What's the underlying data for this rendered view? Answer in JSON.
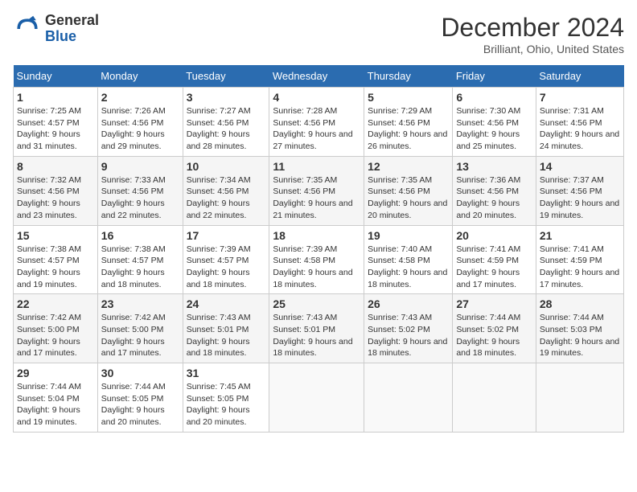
{
  "header": {
    "logo_general": "General",
    "logo_blue": "Blue",
    "month_title": "December 2024",
    "location": "Brilliant, Ohio, United States"
  },
  "days_of_week": [
    "Sunday",
    "Monday",
    "Tuesday",
    "Wednesday",
    "Thursday",
    "Friday",
    "Saturday"
  ],
  "weeks": [
    [
      {
        "day": "1",
        "sunrise": "7:25 AM",
        "sunset": "4:57 PM",
        "daylight": "9 hours and 31 minutes."
      },
      {
        "day": "2",
        "sunrise": "7:26 AM",
        "sunset": "4:56 PM",
        "daylight": "9 hours and 29 minutes."
      },
      {
        "day": "3",
        "sunrise": "7:27 AM",
        "sunset": "4:56 PM",
        "daylight": "9 hours and 28 minutes."
      },
      {
        "day": "4",
        "sunrise": "7:28 AM",
        "sunset": "4:56 PM",
        "daylight": "9 hours and 27 minutes."
      },
      {
        "day": "5",
        "sunrise": "7:29 AM",
        "sunset": "4:56 PM",
        "daylight": "9 hours and 26 minutes."
      },
      {
        "day": "6",
        "sunrise": "7:30 AM",
        "sunset": "4:56 PM",
        "daylight": "9 hours and 25 minutes."
      },
      {
        "day": "7",
        "sunrise": "7:31 AM",
        "sunset": "4:56 PM",
        "daylight": "9 hours and 24 minutes."
      }
    ],
    [
      {
        "day": "8",
        "sunrise": "7:32 AM",
        "sunset": "4:56 PM",
        "daylight": "9 hours and 23 minutes."
      },
      {
        "day": "9",
        "sunrise": "7:33 AM",
        "sunset": "4:56 PM",
        "daylight": "9 hours and 22 minutes."
      },
      {
        "day": "10",
        "sunrise": "7:34 AM",
        "sunset": "4:56 PM",
        "daylight": "9 hours and 22 minutes."
      },
      {
        "day": "11",
        "sunrise": "7:35 AM",
        "sunset": "4:56 PM",
        "daylight": "9 hours and 21 minutes."
      },
      {
        "day": "12",
        "sunrise": "7:35 AM",
        "sunset": "4:56 PM",
        "daylight": "9 hours and 20 minutes."
      },
      {
        "day": "13",
        "sunrise": "7:36 AM",
        "sunset": "4:56 PM",
        "daylight": "9 hours and 20 minutes."
      },
      {
        "day": "14",
        "sunrise": "7:37 AM",
        "sunset": "4:56 PM",
        "daylight": "9 hours and 19 minutes."
      }
    ],
    [
      {
        "day": "15",
        "sunrise": "7:38 AM",
        "sunset": "4:57 PM",
        "daylight": "9 hours and 19 minutes."
      },
      {
        "day": "16",
        "sunrise": "7:38 AM",
        "sunset": "4:57 PM",
        "daylight": "9 hours and 18 minutes."
      },
      {
        "day": "17",
        "sunrise": "7:39 AM",
        "sunset": "4:57 PM",
        "daylight": "9 hours and 18 minutes."
      },
      {
        "day": "18",
        "sunrise": "7:39 AM",
        "sunset": "4:58 PM",
        "daylight": "9 hours and 18 minutes."
      },
      {
        "day": "19",
        "sunrise": "7:40 AM",
        "sunset": "4:58 PM",
        "daylight": "9 hours and 18 minutes."
      },
      {
        "day": "20",
        "sunrise": "7:41 AM",
        "sunset": "4:59 PM",
        "daylight": "9 hours and 17 minutes."
      },
      {
        "day": "21",
        "sunrise": "7:41 AM",
        "sunset": "4:59 PM",
        "daylight": "9 hours and 17 minutes."
      }
    ],
    [
      {
        "day": "22",
        "sunrise": "7:42 AM",
        "sunset": "5:00 PM",
        "daylight": "9 hours and 17 minutes."
      },
      {
        "day": "23",
        "sunrise": "7:42 AM",
        "sunset": "5:00 PM",
        "daylight": "9 hours and 17 minutes."
      },
      {
        "day": "24",
        "sunrise": "7:43 AM",
        "sunset": "5:01 PM",
        "daylight": "9 hours and 18 minutes."
      },
      {
        "day": "25",
        "sunrise": "7:43 AM",
        "sunset": "5:01 PM",
        "daylight": "9 hours and 18 minutes."
      },
      {
        "day": "26",
        "sunrise": "7:43 AM",
        "sunset": "5:02 PM",
        "daylight": "9 hours and 18 minutes."
      },
      {
        "day": "27",
        "sunrise": "7:44 AM",
        "sunset": "5:02 PM",
        "daylight": "9 hours and 18 minutes."
      },
      {
        "day": "28",
        "sunrise": "7:44 AM",
        "sunset": "5:03 PM",
        "daylight": "9 hours and 19 minutes."
      }
    ],
    [
      {
        "day": "29",
        "sunrise": "7:44 AM",
        "sunset": "5:04 PM",
        "daylight": "9 hours and 19 minutes."
      },
      {
        "day": "30",
        "sunrise": "7:44 AM",
        "sunset": "5:05 PM",
        "daylight": "9 hours and 20 minutes."
      },
      {
        "day": "31",
        "sunrise": "7:45 AM",
        "sunset": "5:05 PM",
        "daylight": "9 hours and 20 minutes."
      },
      null,
      null,
      null,
      null
    ]
  ]
}
